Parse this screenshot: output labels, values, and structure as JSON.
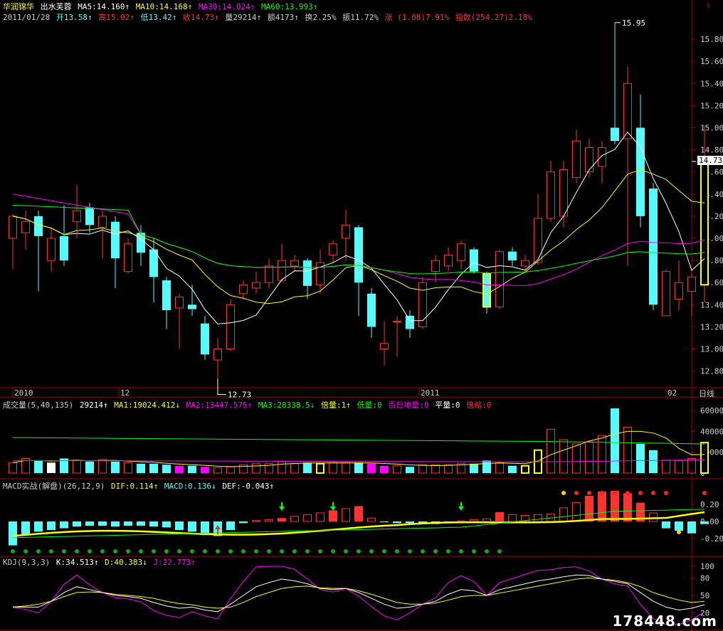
{
  "colors": {
    "bg": "#000000",
    "up": "#ff3232",
    "down": "#54fcfc",
    "grid": "#aa0000",
    "ma5": "#ffffff",
    "ma10": "#ffff00",
    "ma30": "#ff00ff",
    "ma60": "#00ff00",
    "yellow": "#ffff00",
    "text": "#cccccc"
  },
  "header": {
    "stock_name": "华润锦华",
    "tag": "出水芙蓉",
    "ma5": "MA5:14.160↑",
    "ma10": "MA10:14.168↑",
    "ma30": "MA30:14.024↑",
    "ma60": "MA60:13.993↑",
    "date": "2011/01/28",
    "open": "开13.58↑",
    "high": "高15.02↑",
    "low": "低13.42↑",
    "close": "收14.73↑",
    "vol": "量29214↑",
    "amount": "额4173↑",
    "turnover": "换2.25%",
    "amplitude": "振11.72%",
    "rise": "涨 (1.08)7.91%",
    "index": "指数(254.27)2.18%"
  },
  "price_axis": [
    "15.80",
    "15.60",
    "15.40",
    "15.20",
    "15.00",
    "14.80",
    "14.60",
    "14.40",
    "14.20",
    "14.00",
    "13.80",
    "13.60",
    "13.40",
    "13.20",
    "13.00",
    "12.80"
  ],
  "current_price": "14.73",
  "high_label": "15.95",
  "low_label": "12.73",
  "time_axis": {
    "labels": [
      "2010",
      "12",
      "2011",
      "02"
    ],
    "period": "日线"
  },
  "volume_header": {
    "title": "成交量(5,40,135)",
    "value": "29214↑",
    "ma1": "MA1:19024.412↓",
    "ma2": "MA2:13447.575↑",
    "ma3": "MA3:28338.5↓",
    "double": "倍量:1↑",
    "low": "低量:0",
    "hundred_low": "百日地量:0",
    "flat": "平量:0",
    "shrink": "倍缩:0"
  },
  "volume_axis": [
    "60000",
    "40000",
    "20000",
    "0"
  ],
  "macd_header": {
    "title": "MACD实战(解盘)(26,12,9)",
    "dif": "DIF:0.114↑",
    "macd": "MACD:0.136↓",
    "def": "DEF:-0.043↑"
  },
  "macd_axis": [
    "0.20",
    "0.00",
    "-0.20"
  ],
  "kdj_header": {
    "title": "KDJ(9,3,3)",
    "k": "K:34.513↑",
    "d": "D:40.383↓",
    "j": "J:22.773↑"
  },
  "kdj_axis": [
    "100",
    "80",
    "50",
    "20"
  ],
  "watermark": "178448.com",
  "chart_data": {
    "type": "candlestick",
    "candles": [
      {
        "o": 14.0,
        "c": 14.2,
        "h": 14.22,
        "l": 13.72
      },
      {
        "o": 14.05,
        "c": 14.15,
        "h": 14.25,
        "l": 13.9
      },
      {
        "o": 14.2,
        "c": 14.02,
        "h": 14.25,
        "l": 13.52
      },
      {
        "o": 13.8,
        "c": 14.0,
        "h": 14.1,
        "l": 13.7
      },
      {
        "o": 14.02,
        "c": 13.8,
        "h": 14.3,
        "l": 13.75
      },
      {
        "o": 14.15,
        "c": 14.25,
        "h": 14.48,
        "l": 14.0
      },
      {
        "o": 14.28,
        "c": 14.12,
        "h": 14.32,
        "l": 14.05
      },
      {
        "o": 14.1,
        "c": 14.2,
        "h": 14.25,
        "l": 13.82
      },
      {
        "o": 14.15,
        "c": 13.82,
        "h": 14.2,
        "l": 13.55
      },
      {
        "o": 13.7,
        "c": 13.95,
        "h": 14.0,
        "l": 13.68
      },
      {
        "o": 14.05,
        "c": 13.87,
        "h": 14.12,
        "l": 13.75
      },
      {
        "o": 13.9,
        "c": 13.65,
        "h": 14.0,
        "l": 13.42
      },
      {
        "o": 13.62,
        "c": 13.35,
        "h": 13.65,
        "l": 13.18
      },
      {
        "o": 13.37,
        "c": 13.47,
        "h": 13.5,
        "l": 13.0
      },
      {
        "o": 13.4,
        "c": 13.36,
        "h": 13.58,
        "l": 13.3
      },
      {
        "o": 13.23,
        "c": 12.95,
        "h": 13.3,
        "l": 12.9
      },
      {
        "o": 12.9,
        "c": 13.0,
        "h": 13.1,
        "l": 12.73
      },
      {
        "o": 13.0,
        "c": 13.4,
        "h": 13.45,
        "l": 12.98
      },
      {
        "o": 13.5,
        "c": 13.58,
        "h": 13.62,
        "l": 13.45
      },
      {
        "o": 13.55,
        "c": 13.6,
        "h": 13.7,
        "l": 13.5
      },
      {
        "o": 13.6,
        "c": 13.75,
        "h": 13.82,
        "l": 13.55
      },
      {
        "o": 13.62,
        "c": 13.8,
        "h": 13.95,
        "l": 13.6
      },
      {
        "o": 13.75,
        "c": 13.8,
        "h": 13.85,
        "l": 13.7
      },
      {
        "o": 13.8,
        "c": 13.57,
        "h": 13.82,
        "l": 13.45
      },
      {
        "o": 13.58,
        "c": 13.78,
        "h": 13.9,
        "l": 13.5
      },
      {
        "o": 13.85,
        "c": 13.95,
        "h": 13.98,
        "l": 13.78
      },
      {
        "o": 14.0,
        "c": 14.12,
        "h": 14.26,
        "l": 13.8
      },
      {
        "o": 14.1,
        "c": 13.6,
        "h": 14.12,
        "l": 13.3
      },
      {
        "o": 13.5,
        "c": 13.2,
        "h": 13.55,
        "l": 13.1
      },
      {
        "o": 13.0,
        "c": 13.05,
        "h": 13.25,
        "l": 12.85
      },
      {
        "o": 13.25,
        "c": 13.25,
        "h": 13.3,
        "l": 12.93
      },
      {
        "o": 13.3,
        "c": 13.18,
        "h": 13.35,
        "l": 13.1
      },
      {
        "o": 13.2,
        "c": 13.6,
        "h": 13.65,
        "l": 13.18
      },
      {
        "o": 13.7,
        "c": 13.8,
        "h": 13.85,
        "l": 13.6
      },
      {
        "o": 13.75,
        "c": 13.85,
        "h": 13.92,
        "l": 13.7
      },
      {
        "o": 13.8,
        "c": 13.95,
        "h": 13.98,
        "l": 13.72
      },
      {
        "o": 13.9,
        "c": 13.7,
        "h": 13.92,
        "l": 13.68
      },
      {
        "o": 13.68,
        "c": 13.38,
        "h": 13.7,
        "l": 13.32
      },
      {
        "o": 13.38,
        "c": 13.88,
        "h": 13.9,
        "l": 13.36
      },
      {
        "o": 13.88,
        "c": 13.8,
        "h": 13.92,
        "l": 13.75
      },
      {
        "o": 13.75,
        "c": 13.8,
        "h": 13.85,
        "l": 13.68
      },
      {
        "o": 13.78,
        "c": 14.18,
        "h": 14.4,
        "l": 13.76
      },
      {
        "o": 14.18,
        "c": 14.6,
        "h": 14.7,
        "l": 14.15
      },
      {
        "o": 14.2,
        "c": 14.62,
        "h": 14.7,
        "l": 14.1
      },
      {
        "o": 14.55,
        "c": 14.88,
        "h": 14.98,
        "l": 14.5
      },
      {
        "o": 14.6,
        "c": 14.82,
        "h": 14.9,
        "l": 14.55
      },
      {
        "o": 14.65,
        "c": 14.82,
        "h": 14.88,
        "l": 14.5
      },
      {
        "o": 15.0,
        "c": 14.88,
        "h": 15.95,
        "l": 14.85
      },
      {
        "o": 14.9,
        "c": 15.4,
        "h": 15.55,
        "l": 13.75
      },
      {
        "o": 15.0,
        "c": 14.2,
        "h": 15.3,
        "l": 14.1
      },
      {
        "o": 14.45,
        "c": 13.4,
        "h": 14.5,
        "l": 13.35
      },
      {
        "o": 13.3,
        "c": 13.7,
        "h": 13.72,
        "l": 13.3
      },
      {
        "o": 13.45,
        "c": 13.6,
        "h": 13.8,
        "l": 13.35
      },
      {
        "o": 13.52,
        "c": 13.65,
        "h": 13.68,
        "l": 13.3
      },
      {
        "o": 13.58,
        "c": 14.73,
        "h": 15.02,
        "l": 13.42
      }
    ]
  }
}
